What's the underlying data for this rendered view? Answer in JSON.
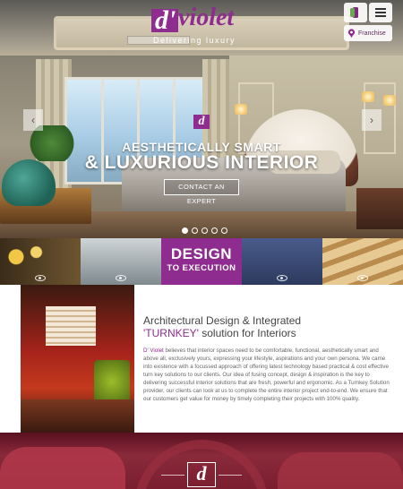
{
  "brand": {
    "logo_mark": "d'",
    "logo_word": "violet",
    "tagline": "Delivering luxury"
  },
  "header": {
    "franchise_label": "Franchise",
    "phone_icon": "phone-icon",
    "menu_icon": "hamburger-menu-icon"
  },
  "hero": {
    "mark": "d",
    "line1": "AESTHETICALLY SMART",
    "line2": "& LUXURIOUS INTERIOR",
    "cta": "CONTACT AN EXPERT",
    "prev_glyph": "‹",
    "next_glyph": "›",
    "slide_count": 5,
    "active_slide": 1
  },
  "strip": {
    "design_line1": "DESIGN",
    "design_line2": "TO EXECUTION"
  },
  "about": {
    "title_line1": "Architectural Design & Integrated",
    "title_highlight": "'TURNKEY'",
    "title_line2_rest": " solution for Interiors",
    "body_brand": "D' Violet",
    "body": " believes that interior spaces need to be comfortable, functional, aesthetically smart and above all, exclusively yours, expressing your lifestyle, aspirations and your own persona. We came into existence with a focussed approach of offering latest technology based practical & cost effective turn key solutions to our clients. Our idea of fusing concept, design & inspiration is the key to delivering successful interior solutions that are fresh, powerful and ergonomic. As a Turnkey Solution provider, our clients can look at us to complete the entire interior project end-to-end. We ensure that our customers get value for money by timely completing their projects with 100% quality."
  },
  "footer_band": {
    "mark": "d"
  },
  "colors": {
    "brand_purple": "#8e2c8f",
    "text_gray": "#666666"
  }
}
